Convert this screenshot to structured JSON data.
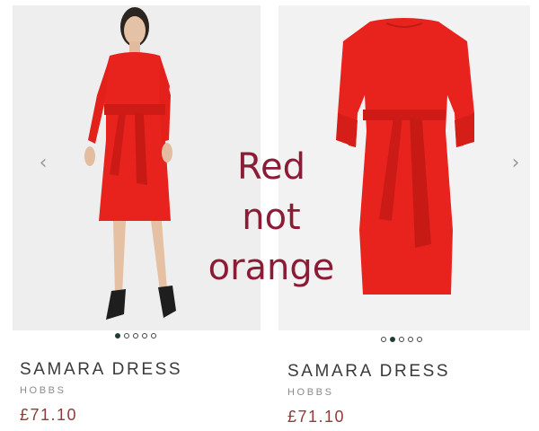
{
  "products": [
    {
      "name": "SAMARA DRESS",
      "brand": "HOBBS",
      "price": "£71.10",
      "nav_icon": "chevron-left-icon",
      "nav_glyph": "‹",
      "carousel": {
        "total": 5,
        "active": 1
      }
    },
    {
      "name": "SAMARA DRESS",
      "brand": "HOBBS",
      "price": "£71.10",
      "nav_icon": "chevron-right-icon",
      "nav_glyph": "›",
      "carousel": {
        "total": 5,
        "active": 2
      }
    }
  ],
  "annotation": {
    "lines": [
      "Red",
      "not",
      "orange"
    ],
    "color": "#8c1c36"
  },
  "colors": {
    "dress": "#e8231d",
    "price": "#8e3b3b",
    "active_dot": "#1f3d39"
  }
}
